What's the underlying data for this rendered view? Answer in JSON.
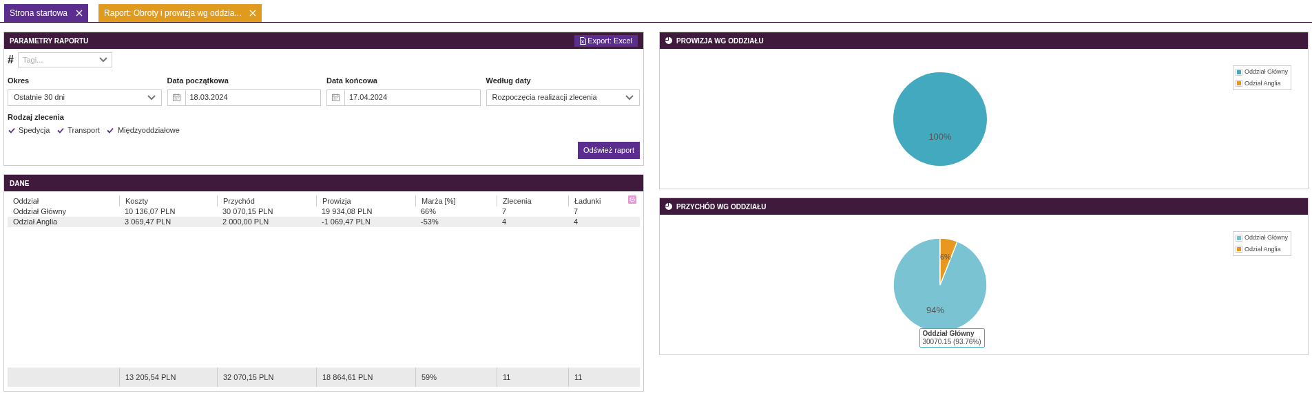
{
  "tabs": [
    {
      "label": "Strona startowa",
      "color": "#5b2d8e"
    },
    {
      "label": "Raport: Obroty i prowizja wg oddzia...",
      "color": "#e09b1f"
    }
  ],
  "params": {
    "title": "PARAMETRY RAPORTU",
    "export_button": "Export: Excel",
    "tags": {
      "hash": "#",
      "placeholder": "Tagi..."
    },
    "fields": [
      {
        "kind": "select",
        "label": "Okres",
        "value": "Ostatnie 30 dni"
      },
      {
        "kind": "date",
        "label": "Data początkowa",
        "value": "18.03.2024"
      },
      {
        "kind": "date",
        "label": "Data końcowa",
        "value": "17.04.2024"
      },
      {
        "kind": "select",
        "label": "Według daty",
        "value": "Rozpoczęcia realizacji zlecenia"
      }
    ],
    "order_type": {
      "label": "Rodzaj zlecenia",
      "options": [
        {
          "label": "Spedycja",
          "checked": true
        },
        {
          "label": "Transport",
          "checked": true
        },
        {
          "label": "Międzyoddziałowe",
          "checked": true
        }
      ]
    },
    "refresh_button": "Odśwież raport"
  },
  "data": {
    "title": "DANE",
    "columns": [
      "Oddział",
      "Koszty",
      "Przychód",
      "Prowizja",
      "Marża [%]",
      "Zlecenia",
      "Ładunki"
    ],
    "rows": [
      [
        "Oddział Główny",
        "10 136,07 PLN",
        "30 070,15 PLN",
        "19 934,08 PLN",
        "66%",
        "7",
        "7"
      ],
      [
        "Odział Anglia",
        "3 069,47 PLN",
        "2 000,00 PLN",
        "-1 069,47 PLN",
        "-53%",
        "4",
        "4"
      ]
    ],
    "totals": [
      "13 205,54 PLN",
      "32 070,15 PLN",
      "18 864,61 PLN",
      "59%",
      "11",
      "11"
    ]
  },
  "charts": [
    {
      "title": "PROWIZJA WG ODDZIAŁU",
      "chart_data": {
        "type": "pie",
        "categories": [
          "Oddział Główny",
          "Odział Anglia"
        ],
        "values": [
          100,
          0
        ],
        "colors": [
          "#43a9bf",
          "#e8971f"
        ],
        "value_labels": [
          "100%",
          null
        ]
      }
    },
    {
      "title": "PRZYCHÓD WG ODDZIAŁU",
      "chart_data": {
        "type": "pie",
        "categories": [
          "Oddział Główny",
          "Odział Anglia"
        ],
        "values": [
          94,
          6
        ],
        "colors": [
          "#79c3d2",
          "#e8971f"
        ],
        "value_labels": [
          "94%",
          "6%"
        ]
      },
      "tooltip": {
        "title": "Oddział Główny",
        "value": "30070.15 (93.76%)"
      }
    }
  ]
}
